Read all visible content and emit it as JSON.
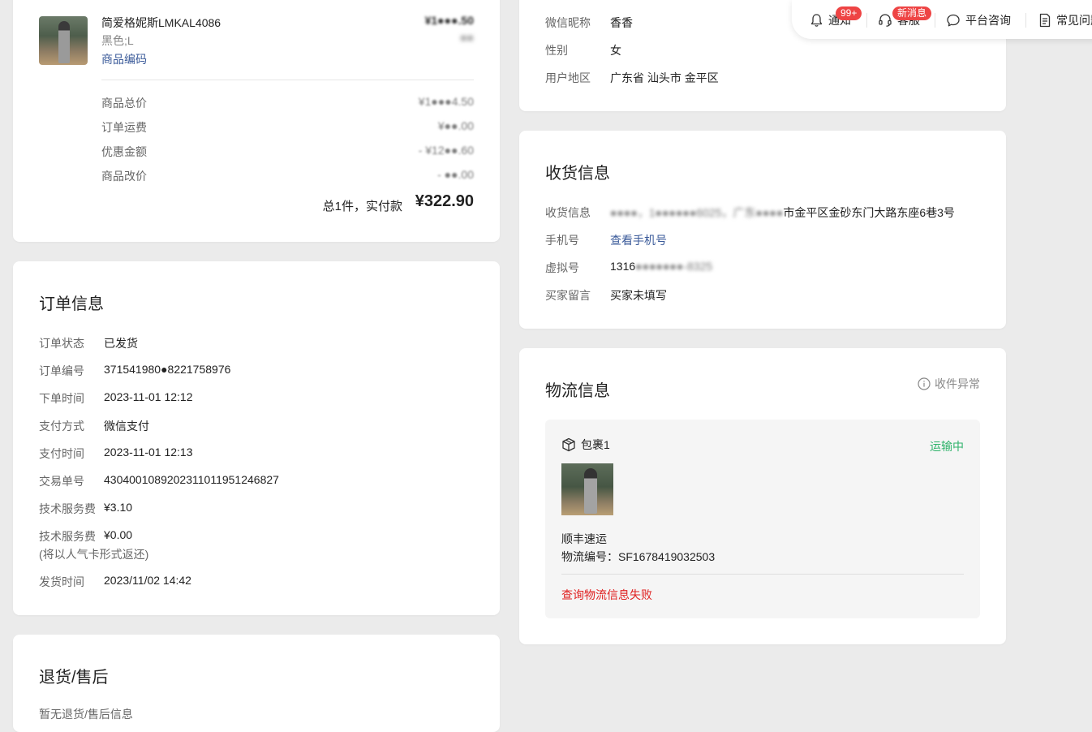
{
  "colors": {
    "page_bg": "#ebebeb",
    "card_bg": "#ffffff",
    "link": "#3a5a99",
    "status_green": "#2fb36b",
    "error_red": "#e02020",
    "badge_red": "#ee4444"
  },
  "topbar": {
    "items": [
      {
        "label": "通知",
        "badge": "99+",
        "icon": "bell-icon"
      },
      {
        "label": "客服",
        "badge": "新消息",
        "icon": "headset-icon"
      },
      {
        "label": "平台咨询",
        "icon": "chat-bubble-icon"
      },
      {
        "label": "常见问题",
        "icon": "document-icon"
      }
    ]
  },
  "product": {
    "name": "简爱格妮斯LMKAL4086",
    "spec": "黑色;L",
    "code_link": "商品编码",
    "price": "¥1●●●.50",
    "qty": "●●",
    "summary": [
      {
        "label": "商品总价",
        "value": "¥1●●●4.50"
      },
      {
        "label": "订单运费",
        "value": "¥●●.00"
      },
      {
        "label": "优惠金额",
        "value": "- ¥12●●.60"
      },
      {
        "label": "商品改价",
        "value": "- ●●.00"
      }
    ],
    "total_prefix": "总1件，实付款",
    "total_value": "¥322.90"
  },
  "order_info": {
    "title": "订单信息",
    "rows": [
      {
        "label": "订单状态",
        "value": "已发货"
      },
      {
        "label": "订单编号",
        "value": "371541980●8221758976"
      },
      {
        "label": "下单时间",
        "value": "2023-11-01 12:12"
      },
      {
        "label": "支付方式",
        "value": "微信支付"
      },
      {
        "label": "支付时间",
        "value": "2023-11-01 12:13"
      },
      {
        "label": "交易单号",
        "value": "4304001089202311011951246827"
      },
      {
        "label": "技术服务费",
        "value": "¥3.10"
      },
      {
        "label": "技术服务费",
        "value": "¥0.00"
      }
    ],
    "note": "(将以人气卡形式返还)",
    "ship_label": "发货时间",
    "ship_value": "2023/11/02 14:42"
  },
  "after_sale": {
    "title": "退货/售后",
    "sub": "暂无退货/售后信息"
  },
  "user_info": {
    "rows": [
      {
        "label": "微信昵称",
        "value": "香香"
      },
      {
        "label": "性别",
        "value": "女"
      },
      {
        "label": "用户地区",
        "value": "广东省 汕头市 金平区"
      }
    ]
  },
  "receiver": {
    "title": "收货信息",
    "rows": [
      {
        "label": "收货信息",
        "value_blur": "●●●●，1●●●●●●6025，广东●●●●",
        "value": "市金平区金砂东门大路东座6巷3号"
      },
      {
        "label": "手机号",
        "value": "查看手机号"
      },
      {
        "label": "虚拟号",
        "value": "1316",
        "value_blur": "●●●●●●●-8325"
      },
      {
        "label": "买家留言",
        "value": "买家未填写"
      }
    ]
  },
  "logistics": {
    "title": "物流信息",
    "exception": "收件异常",
    "package_name": "包裹1",
    "status": "运输中",
    "carrier": "顺丰速运",
    "tracking": "物流编号：SF1678419032503",
    "error": "查询物流信息失败"
  }
}
